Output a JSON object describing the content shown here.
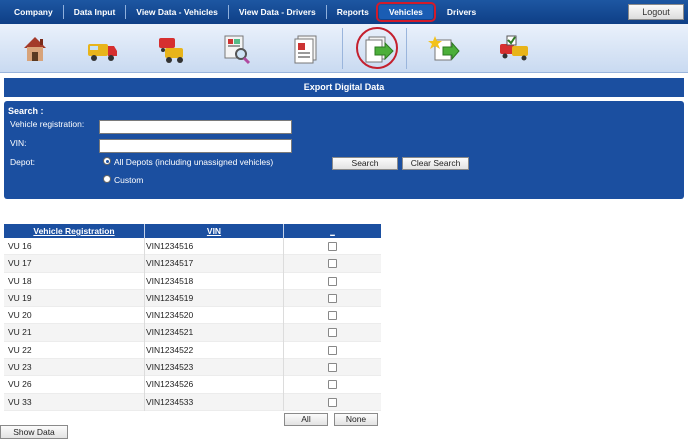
{
  "nav": {
    "items": [
      "Company",
      "Data Input",
      "View Data - Vehicles",
      "View Data - Drivers",
      "Reports",
      "Vehicles",
      "Drivers"
    ],
    "highlighted_index": 5,
    "logout_label": "Logout"
  },
  "toolbar": {
    "icons": [
      "house-icon",
      "van-icon",
      "trucks-icon",
      "report-search-icon",
      "document-icon",
      "export-data-icon",
      "favorite-arrow-icon",
      "vehicles-check-icon"
    ],
    "active_index": 5
  },
  "colors": {
    "panel_blue": "#1b4fa0",
    "highlight_red": "#d21b2a"
  },
  "page": {
    "title": "Export Digital Data"
  },
  "search": {
    "title": "Search :",
    "vehicle_reg_label": "Vehicle registration:",
    "vehicle_reg_value": "",
    "vin_label": "VIN:",
    "vin_value": "",
    "depot_label": "Depot:",
    "depot_options": [
      "All Depots (including unassigned vehicles)",
      "Custom"
    ],
    "depot_selected": 0,
    "search_button": "Search",
    "clear_button": "Clear Search"
  },
  "table": {
    "headers": [
      "Vehicle Registration",
      "VIN",
      "_"
    ],
    "rows": [
      {
        "reg": "VU 16",
        "vin": "VIN1234516",
        "checked": false
      },
      {
        "reg": "VU 17",
        "vin": "VIN1234517",
        "checked": false
      },
      {
        "reg": "VU 18",
        "vin": "VIN1234518",
        "checked": false
      },
      {
        "reg": "VU 19",
        "vin": "VIN1234519",
        "checked": false
      },
      {
        "reg": "VU 20",
        "vin": "VIN1234520",
        "checked": false
      },
      {
        "reg": "VU 21",
        "vin": "VIN1234521",
        "checked": false
      },
      {
        "reg": "VU 22",
        "vin": "VIN1234522",
        "checked": false
      },
      {
        "reg": "VU 23",
        "vin": "VIN1234523",
        "checked": false
      },
      {
        "reg": "VU 26",
        "vin": "VIN1234526",
        "checked": false
      },
      {
        "reg": "VU 33",
        "vin": "VIN1234533",
        "checked": false
      }
    ],
    "all_button": "All",
    "none_button": "None"
  },
  "show_data_button": "Show Data"
}
